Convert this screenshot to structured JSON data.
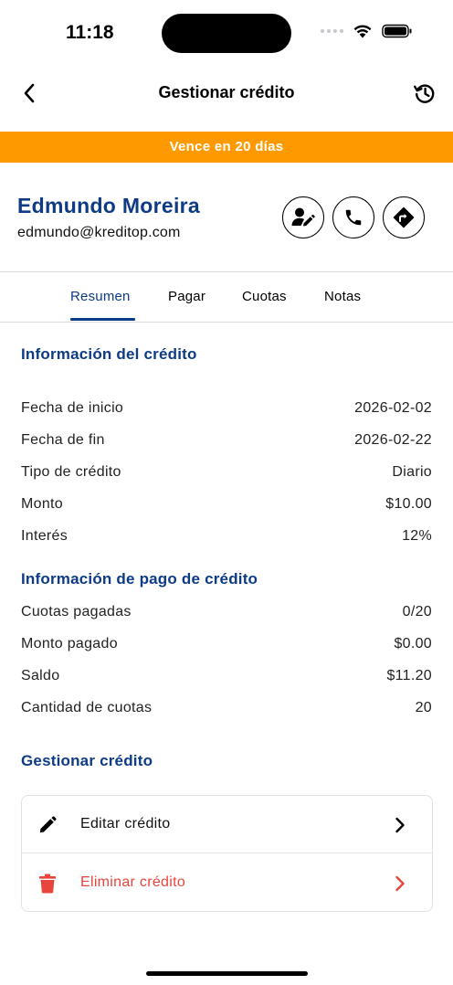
{
  "status_bar": {
    "time": "11:18"
  },
  "nav": {
    "title": "Gestionar crédito"
  },
  "banner": {
    "text": "Vence en 20 días"
  },
  "client": {
    "name": "Edmundo Moreira",
    "email": "edmundo@kreditop.com"
  },
  "tabs": [
    {
      "label": "Resumen",
      "active": true
    },
    {
      "label": "Pagar",
      "active": false
    },
    {
      "label": "Cuotas",
      "active": false
    },
    {
      "label": "Notas",
      "active": false
    }
  ],
  "credit_info": {
    "title": "Información del crédito",
    "rows": [
      {
        "label": "Fecha de inicio",
        "value": "2026-02-02"
      },
      {
        "label": "Fecha de fin",
        "value": "2026-02-22"
      },
      {
        "label": "Tipo de crédito",
        "value": "Diario"
      },
      {
        "label": "Monto",
        "value": "$10.00"
      },
      {
        "label": "Interés",
        "value": "12%"
      }
    ]
  },
  "payment_info": {
    "title": "Información de pago de crédito",
    "rows": [
      {
        "label": "Cuotas pagadas",
        "value": "0/20"
      },
      {
        "label": "Monto pagado",
        "value": "$0.00"
      },
      {
        "label": "Saldo",
        "value": "$11.20"
      },
      {
        "label": "Cantidad de cuotas",
        "value": "20"
      }
    ]
  },
  "manage": {
    "title": "Gestionar crédito",
    "edit_label": "Editar crédito",
    "delete_label": "Eliminar crédito"
  },
  "colors": {
    "brand": "#0d3b86",
    "banner": "#ff9900",
    "danger": "#e8453c"
  },
  "icons": {
    "back": "chevron-left-icon",
    "history": "history-icon",
    "edit_contact": "user-edit-icon",
    "call": "phone-icon",
    "directions": "directions-icon",
    "edit": "pencil-icon",
    "delete": "trash-icon"
  }
}
